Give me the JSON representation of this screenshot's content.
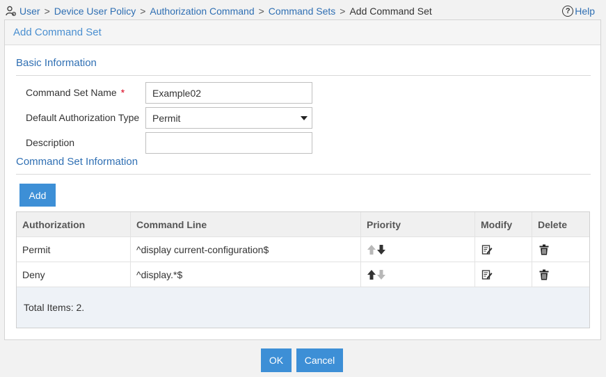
{
  "breadcrumb": {
    "items": [
      "User",
      "Device User Policy",
      "Authorization Command",
      "Command Sets"
    ],
    "current": "Add Command Set",
    "separator": ">"
  },
  "help": {
    "label": "Help"
  },
  "panel": {
    "title": "Add Command Set"
  },
  "basic": {
    "title": "Basic Information",
    "name_label": "Command Set Name",
    "required_mark": "*",
    "name_value": "Example02",
    "type_label": "Default Authorization Type",
    "type_value": "Permit",
    "desc_label": "Description",
    "desc_value": ""
  },
  "commands": {
    "title": "Command Set Information",
    "add_label": "Add",
    "columns": [
      "Authorization",
      "Command Line",
      "Priority",
      "Modify",
      "Delete"
    ],
    "rows": [
      {
        "authorization": "Permit",
        "command": "^display current-configuration$",
        "up_enabled": false,
        "down_enabled": true
      },
      {
        "authorization": "Deny",
        "command": "^display.*$",
        "up_enabled": true,
        "down_enabled": false
      }
    ],
    "total": "Total Items: 2."
  },
  "footer": {
    "ok_label": "OK",
    "cancel_label": "Cancel"
  },
  "colors": {
    "accent": "#3d8fd6",
    "link": "#2f6fb3",
    "required": "#d9001b"
  }
}
